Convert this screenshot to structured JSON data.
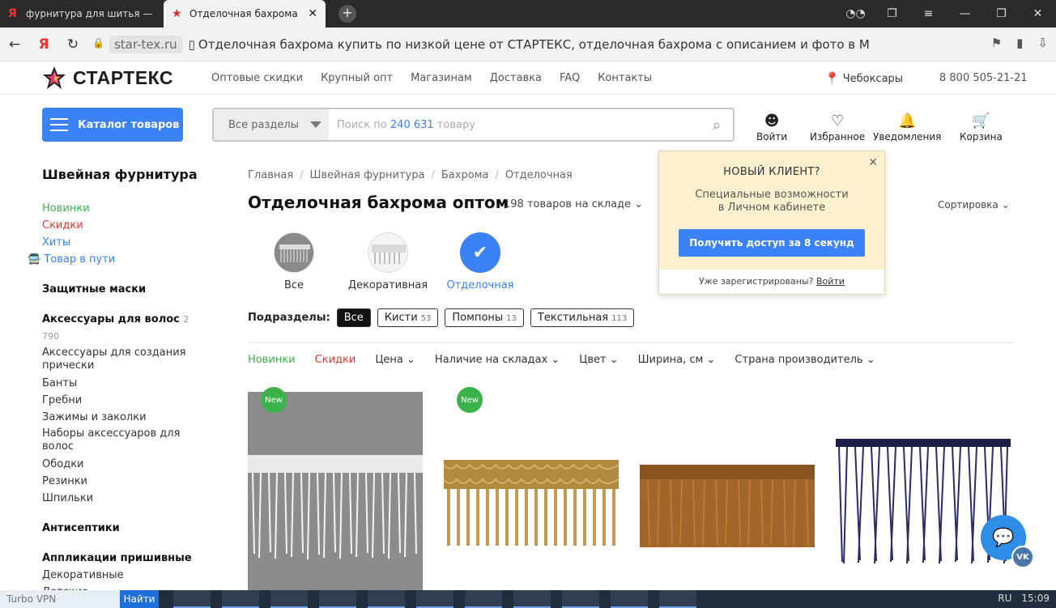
{
  "browser": {
    "tabs": [
      {
        "favicon": "Я",
        "title": "фурнитура для шитья — Я",
        "active": false
      },
      {
        "favicon": "★",
        "title": "Отделочная бахрома",
        "active": true
      }
    ],
    "url_host": "star-tex.ru",
    "page_title": "Отделочная бахрома купить по низкой цене от СТАРТЕКС, отделочная бахрома с описанием и фото в Москве"
  },
  "site": {
    "logo": "СТАРТЕКС",
    "top_nav": [
      "Оптовые скидки",
      "Крупный опт",
      "Магазинам",
      "Доставка",
      "FAQ",
      "Контакты"
    ],
    "city": "Чебоксары",
    "phone": "8 800 505-21-21"
  },
  "catalog": {
    "button": "Каталог товаров",
    "search_category": "Все разделы",
    "search_prefix": "Поиск по ",
    "search_count": "240 631",
    "search_suffix": " товару"
  },
  "user_icons": {
    "login": "Войти",
    "favorites": "Избранное",
    "notifications": "Уведомления",
    "cart": "Корзина"
  },
  "sidebar": {
    "title": "Швейная фурнитура",
    "promo": {
      "new": "Новинки",
      "sale": "Скидки",
      "hits": "Хиты",
      "transit": "Товар в пути"
    },
    "masks": "Защитные маски",
    "hair_title": "Аксессуары для волос",
    "hair_count": "2 790",
    "hair_items": [
      "Аксессуары для создания прически",
      "Банты",
      "Гребни",
      "Зажимы и заколки",
      "Наборы аксессуаров для волос",
      "Ободки",
      "Резинки",
      "Шпильки"
    ],
    "antiseptics": "Антисептики",
    "appliques_title": "Аппликации пришивные",
    "appliques_items": [
      "Декоративные",
      "Детские"
    ]
  },
  "main": {
    "breadcrumbs": [
      "Главная",
      "Швейная фурнитура",
      "Бахрома",
      "Отделочная"
    ],
    "heading": "Отделочная бахрома оптом",
    "stock": "198 товаров на складе",
    "sort": "Сортировка",
    "categories": [
      {
        "label": "Все"
      },
      {
        "label": "Декоративная"
      },
      {
        "label": "Отделочная"
      }
    ],
    "subsections_label": "Подразделы:",
    "subsections": [
      {
        "label": "Все",
        "count": ""
      },
      {
        "label": "Кисти",
        "count": "53"
      },
      {
        "label": "Помпоны",
        "count": "13"
      },
      {
        "label": "Текстильная",
        "count": "113"
      }
    ],
    "filters": [
      "Новинки",
      "Скидки",
      "Цена",
      "Наличие на складах",
      "Цвет",
      "Ширина, см",
      "Страна производитель"
    ],
    "new_badge": "New"
  },
  "popup": {
    "title": "НОВЫЙ КЛИЕНТ?",
    "text1": "Специальные возможности",
    "text2": "в Личном кабинете",
    "button": "Получить доступ за 8 секунд",
    "footer_text": "Уже зарегистрированы?",
    "footer_link": "Войти"
  },
  "taskbar": {
    "search_placeholder": "Turbo VPN",
    "search_button": "Найти",
    "lang": "RU",
    "time": "15:09"
  }
}
